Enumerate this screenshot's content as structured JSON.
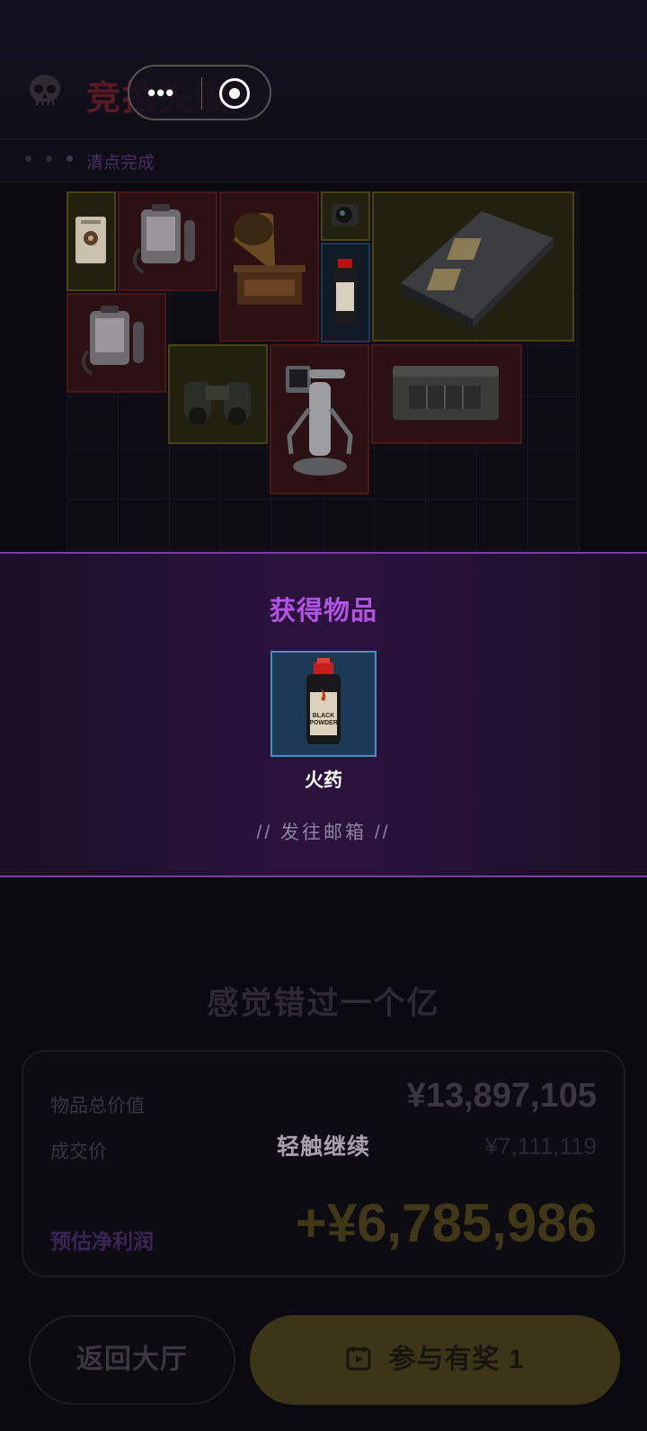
{
  "header": {
    "title": "竞拍失败",
    "capsule_more_icon": "more-dots-icon",
    "capsule_close_icon": "target-close-icon",
    "status_text": "清点完成"
  },
  "inventory": {
    "items": [
      {
        "name": "speaker-item",
        "frame": "gold"
      },
      {
        "name": "oxygen-tank-item",
        "frame": "red"
      },
      {
        "name": "gramophone-item",
        "frame": "red"
      },
      {
        "name": "camera-lens-item",
        "frame": "gold"
      },
      {
        "name": "motherboard-item",
        "frame": "gold"
      },
      {
        "name": "black-powder-item",
        "frame": "blue"
      },
      {
        "name": "oxygen-tank-item",
        "frame": "red"
      },
      {
        "name": "binoculars-item",
        "frame": "gold"
      },
      {
        "name": "robot-item",
        "frame": "red"
      },
      {
        "name": "crate-item",
        "frame": "red"
      }
    ]
  },
  "modal": {
    "title": "获得物品",
    "item_name": "火药",
    "item_label_line1": "BLACK",
    "item_label_line2": "POWDER",
    "mail_hint": "// 发往邮箱 //"
  },
  "result": {
    "slogan": "感觉错过一个亿",
    "total_label": "物品总价值",
    "total_value": "¥13,897,105",
    "deal_label": "成交价",
    "deal_value": "¥7,111,119",
    "continue_hint": "轻触继续",
    "profit_label": "预估净利润",
    "profit_value": "+¥6,785,986"
  },
  "buttons": {
    "back_label": "返回大厅",
    "join_label": "参与有奖 1"
  },
  "colors": {
    "accent_purple": "#b353e6",
    "modal_border": "#7b3ea4",
    "item_blue_frame": "#4a8fc5"
  }
}
